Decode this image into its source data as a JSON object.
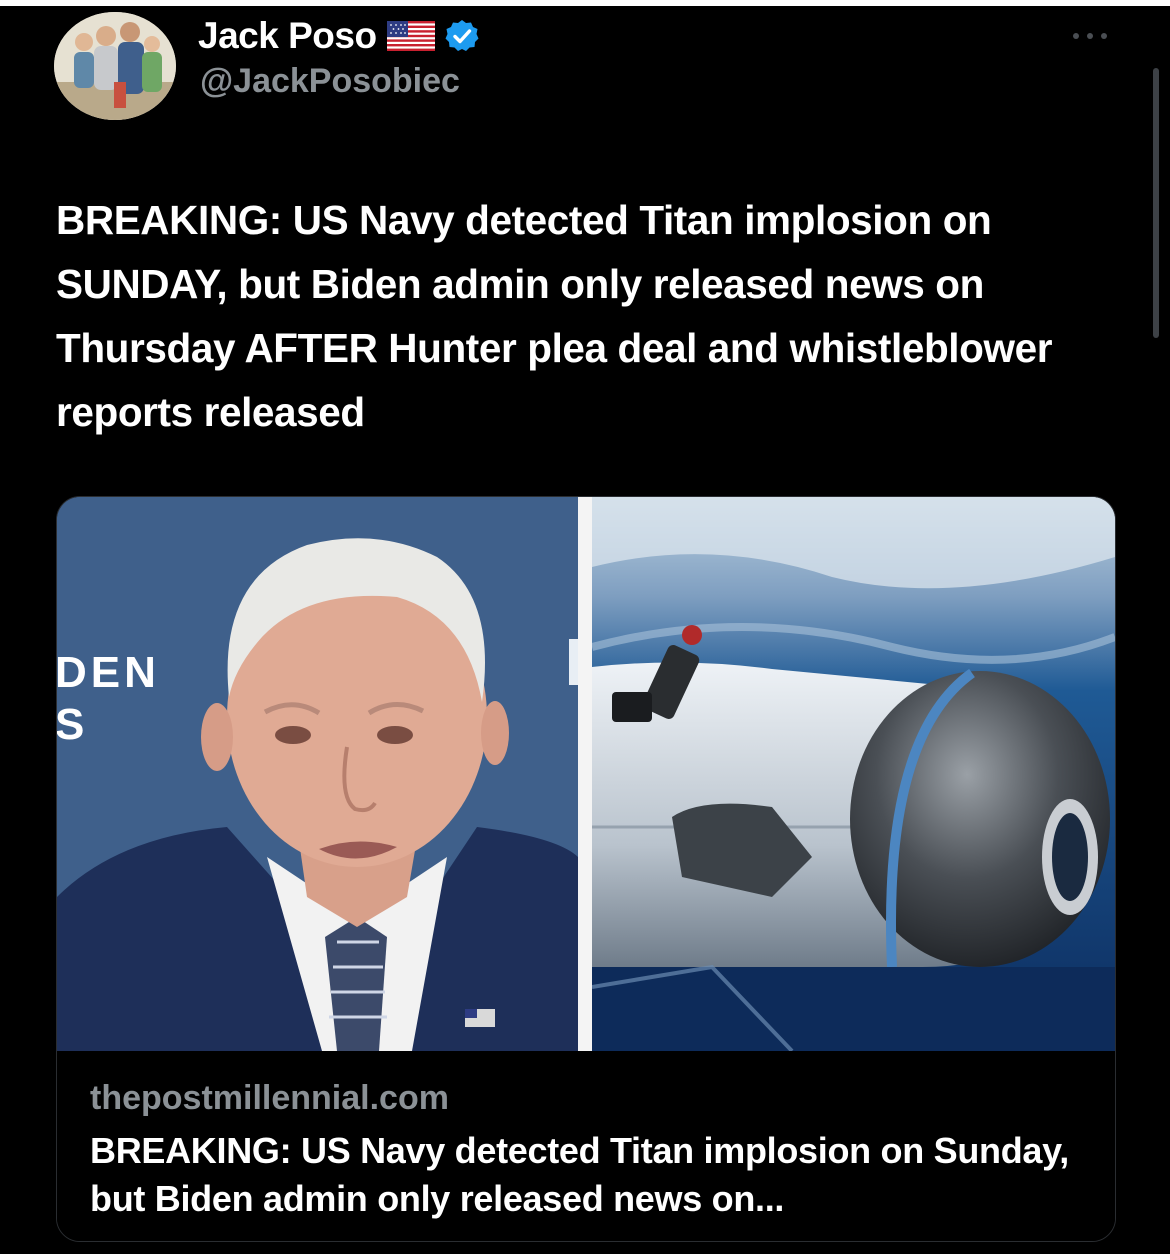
{
  "author": {
    "display_name": "Jack Poso",
    "handle": "@JackPosobiec",
    "flag_icon": "us-flag-icon",
    "verified_icon": "verified-badge-icon",
    "verified_color": "#1d9bf0"
  },
  "menu": {
    "more_icon": "more-options-icon"
  },
  "tweet": {
    "text": "BREAKING: US Navy detected Titan implosion on SUNDAY, but Biden admin only released news on Thursday AFTER Hunter plea deal and whistleblower reports released"
  },
  "link_card": {
    "left_image_backdrop_text": "DEN\nS",
    "right_image_backdrop_text": "",
    "domain": "thepostmillennial.com",
    "title": "BREAKING: US Navy detected Titan implosion on Sunday, but Biden admin only released news on..."
  },
  "colors": {
    "background": "#000000",
    "primary_text": "#ffffff",
    "secondary_text": "#8b9196"
  }
}
